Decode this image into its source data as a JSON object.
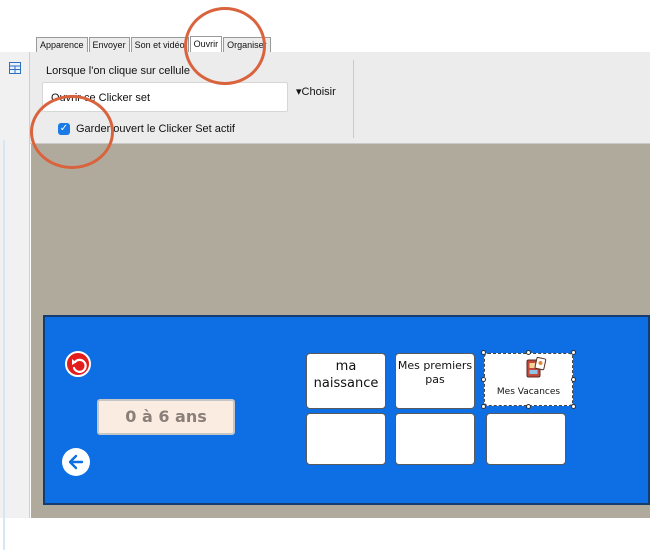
{
  "tabs": [
    "Apparence",
    "Envoyer",
    "Son et vidéo",
    "Ouvrir",
    "Organiser"
  ],
  "active_tab": "Ouvrir",
  "properties": {
    "click_label": "Lorsque l'on clique sur cellule",
    "open_field_value": "Ouvrir ce Clicker set",
    "choose_label": "▾Choisir",
    "keep_open_label": "Garder ouvert le Clicker Set actif",
    "keep_open_checked": true
  },
  "board": {
    "age_label": "0 à 6 ans",
    "back_icon": "red-undo-icon",
    "prev_icon": "left-arrow-icon",
    "cells": [
      {
        "label": "ma naissance"
      },
      {
        "label": "Mes premiers pas"
      },
      {
        "label": "Mes Vacances",
        "icon": "photo-album-icon",
        "selected": true
      },
      {
        "label": ""
      },
      {
        "label": ""
      },
      {
        "label": ""
      }
    ]
  },
  "colors": {
    "board_blue": "#0d6fe3",
    "canvas_taupe": "#b0aa9d",
    "annotation_orange": "#d9633d"
  }
}
